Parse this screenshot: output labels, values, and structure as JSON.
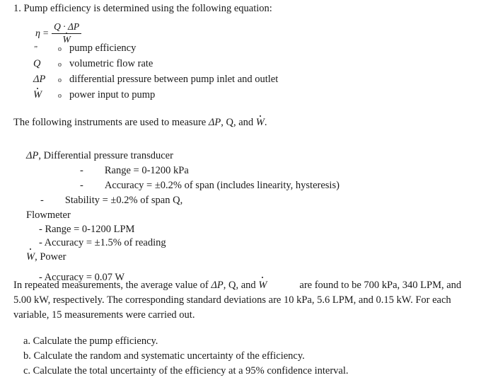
{
  "document": {
    "problem_number_and_title": "1. Pump efficiency is determined using the following equation:",
    "equation": {
      "lhs_symbol": "η",
      "equals": "=",
      "numerator": "Q · ΔP",
      "denominator": "W"
    },
    "definitions": [
      {
        "symbol": "”",
        "bullet": "o",
        "text": "pump efficiency"
      },
      {
        "symbol": "Q",
        "bullet": "o",
        "text": "volumetric flow rate"
      },
      {
        "symbol": "ΔP",
        "bullet": "o",
        "text": "differential pressure between pump inlet and outlet"
      },
      {
        "symbol": "W",
        "bullet": "o",
        "text": "power input to pump"
      }
    ],
    "instruments_lead": {
      "part1": "The following instruments are used to measure ",
      "sym1": "ΔP",
      "part2": ", Q, and ",
      "sym2": "W",
      "part3": "."
    },
    "instruments": {
      "transducer": {
        "heading_symbol": "ΔP",
        "heading_text": ", Differential pressure transducer",
        "lines": [
          {
            "dash": "-",
            "text": "Range = 0-1200 kPa"
          },
          {
            "dash": "-",
            "text": "Accuracy = ±0.2% of span (includes linearity, hysteresis)"
          },
          {
            "dash": "-",
            "text": "Stability = ±0.2% of span Q,"
          }
        ]
      },
      "flowmeter": {
        "heading_text": "Flowmeter",
        "lines": [
          {
            "text": "- Range = 0-1200 LPM"
          },
          {
            "text": "- Accuracy = ±1.5% of reading"
          }
        ]
      },
      "power": {
        "heading_symbol": "W",
        "heading_text": ", Power",
        "lines": [
          {
            "text": "- Accuracy = 0.07 W"
          }
        ]
      }
    },
    "paragraph": {
      "part1": "In repeated measurements, the average value of ",
      "sym1": "ΔP",
      "part2": ", Q, and ",
      "sym2": "W",
      "part3": "are found to be 700 kPa, 340 LPM, and 5.00 kW, respectively. The corresponding standard deviations are 10 kPa, 5.6 LPM, and 0.15 kW. For each variable, 15 measurements were carried out."
    },
    "questions": [
      "a. Calculate the pump efficiency.",
      "b. Calculate the random and systematic uncertainty of the efficiency.",
      "c. Calculate the total uncertainty of the efficiency at a 95% confidence interval."
    ]
  }
}
